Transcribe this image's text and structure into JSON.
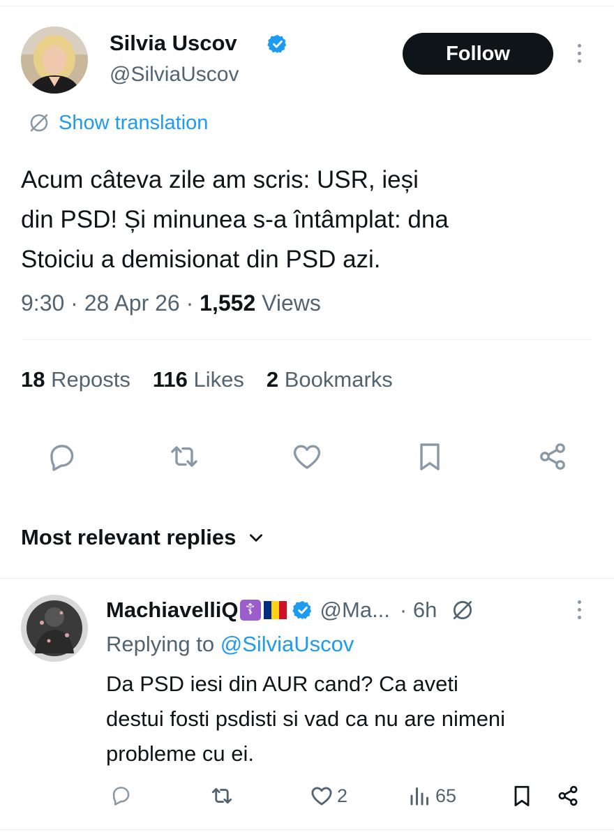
{
  "tweet": {
    "author_name": "Silvia Uscov",
    "author_handle": "@SilviaUscov",
    "follow_label": "Follow",
    "translation_label": "Show translation",
    "text_lines": [
      "Acum câteva zile am scris: USR, ieși",
      "din PSD! Și minunea s-a întâmplat: dna",
      "Stoiciu a demisionat din PSD azi."
    ],
    "time": "9:30",
    "date": "28 Apr 26",
    "views_count": "1,552",
    "views_label": "Views",
    "reposts_count": "18",
    "reposts_label": "Reposts",
    "likes_count": "116",
    "likes_label": "Likes",
    "bookmarks_count": "2",
    "bookmarks_label": "Bookmarks"
  },
  "actions": [
    "reply-icon",
    "repost-icon",
    "like-icon",
    "bookmark-icon",
    "share-icon"
  ],
  "replies_header": "Most relevant replies",
  "reply": {
    "author_name": "MachiavelliQ",
    "cross_emoji": "☦",
    "handle": "@Ma...",
    "time": "· 6h",
    "replying_prefix": "Replying to",
    "replying_to": "@SilviaUscov",
    "text_lines": [
      "Da PSD iesi din AUR cand? Ca aveti",
      "destui fosti psdisti si vad ca nu are nimeni",
      "probleme cu ei."
    ],
    "likes": "2",
    "views": "65"
  },
  "colors": {
    "accent": "#1d9bf0",
    "text": "#0f1419",
    "secondary": "#536471",
    "icon": "#8b98a5",
    "flag": [
      "#002b7f",
      "#fcd116",
      "#ce1126"
    ]
  }
}
